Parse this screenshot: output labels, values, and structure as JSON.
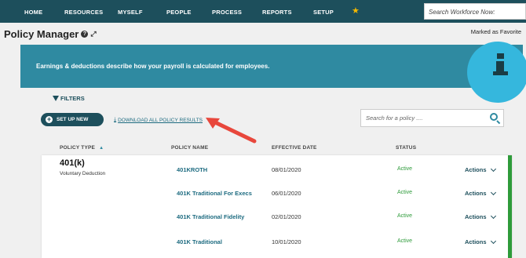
{
  "nav": {
    "items": [
      "HOME",
      "RESOURCES",
      "MYSELF",
      "PEOPLE",
      "PROCESS",
      "REPORTS",
      "SETUP"
    ],
    "favorite_icon": "star-icon",
    "search_placeholder": "Search Workforce Now:"
  },
  "header": {
    "title": "Policy Manager",
    "help_icon": "question-circle-icon",
    "expand_icon": "expand-arrows-icon",
    "favorite_label": "Marked as Favorite"
  },
  "banner": {
    "text": "Earnings & deductions describe how your payroll is calculated for employees.",
    "icon": "info-icon"
  },
  "toolbar": {
    "filters_label": "FILTERS",
    "setup_label": "SET UP NEW",
    "download_label": "DOWNLOAD ALL POLICY RESULTS",
    "search_placeholder": "Search for a policy ...."
  },
  "table": {
    "headers": [
      "POLICY TYPE",
      "POLICY NAME",
      "EFFECTIVE DATE",
      "STATUS"
    ],
    "group": {
      "type": "401(k)",
      "subtype": "Voluntary Deduction"
    },
    "rows": [
      {
        "name": "401KROTH",
        "date": "08/01/2020",
        "status": "Active",
        "action": "Actions"
      },
      {
        "name": "401K Traditional For Execs",
        "date": "06/01/2020",
        "status": "Active",
        "action": "Actions"
      },
      {
        "name": "401K Traditional Fidelity",
        "date": "02/01/2020",
        "status": "Active",
        "action": "Actions"
      },
      {
        "name": "401K Traditional",
        "date": "10/01/2020",
        "status": "Active",
        "action": "Actions"
      }
    ]
  },
  "colors": {
    "nav_bg": "#1d4f5c",
    "banner_bg": "#2f8aa1",
    "status_active": "#2e9b3a",
    "annotation_arrow": "#e8473c"
  }
}
